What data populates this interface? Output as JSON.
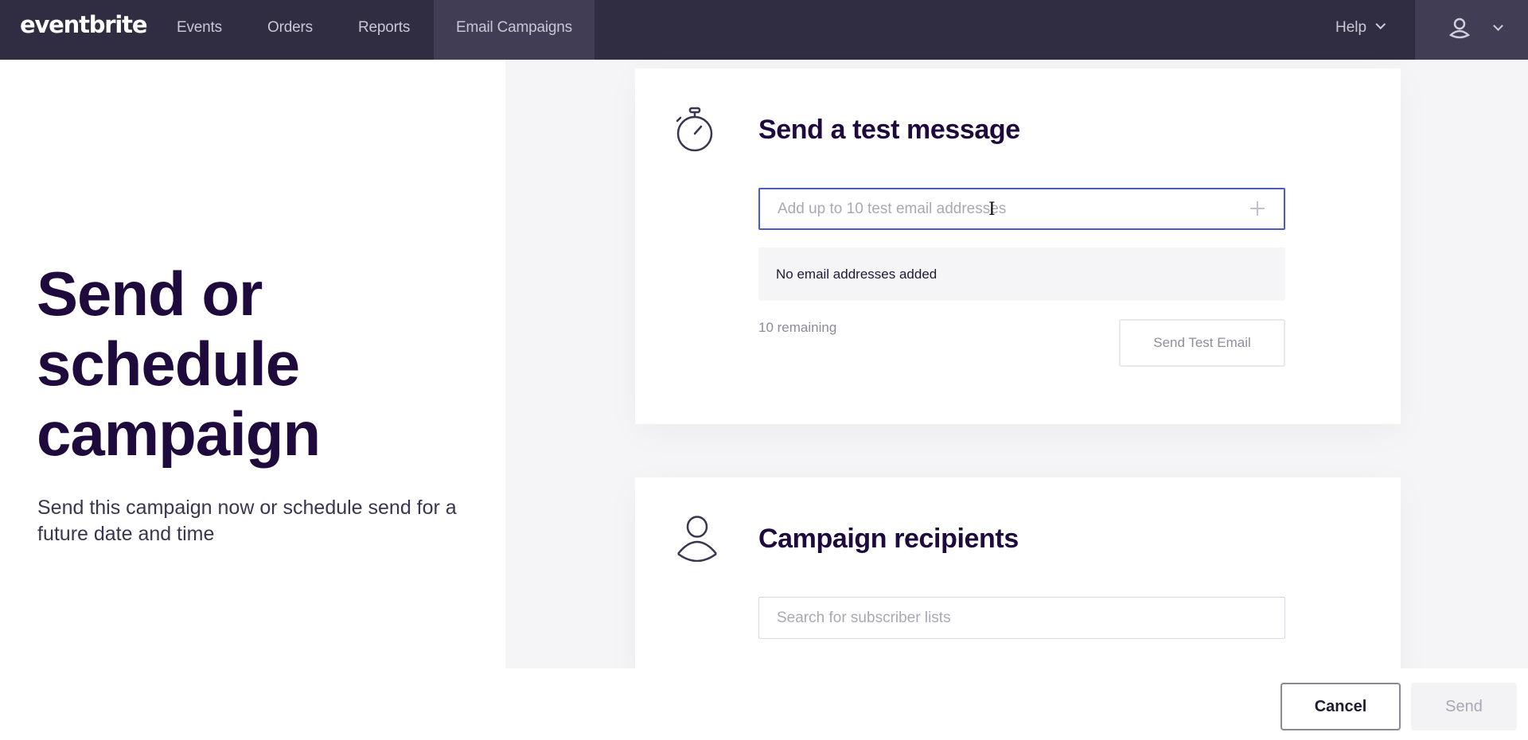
{
  "nav": {
    "logo": "eventbrite",
    "items": [
      {
        "label": "Events",
        "active": false
      },
      {
        "label": "Orders",
        "active": false
      },
      {
        "label": "Reports",
        "active": false
      },
      {
        "label": "Email Campaigns",
        "active": true
      }
    ],
    "help_label": "Help",
    "user_icon": "user-icon",
    "chevron_icon": "chevron-down-icon"
  },
  "hero": {
    "title": "Send or schedule campaign",
    "subtitle": "Send this campaign now or schedule send for a future date and time"
  },
  "test_message": {
    "icon": "stopwatch-icon",
    "title": "Send a test message",
    "email_input": {
      "value": "",
      "placeholder": "Add up to 10 test email addresses"
    },
    "add_icon": "plus-icon",
    "empty_state": "No email addresses added",
    "remaining": "10 remaining",
    "send_test_label": "Send Test Email"
  },
  "recipients": {
    "icon": "person-icon",
    "title": "Campaign recipients",
    "search_input": {
      "value": "",
      "placeholder": "Search for subscriber lists"
    }
  },
  "footer": {
    "cancel_label": "Cancel",
    "send_label": "Send"
  },
  "colors": {
    "nav_bg": "#302d43",
    "nav_active_bg": "#403d55",
    "heading": "#1e0a3c",
    "input_focus": "#4b5bc4",
    "panel_bg": "#f5f5f8"
  }
}
